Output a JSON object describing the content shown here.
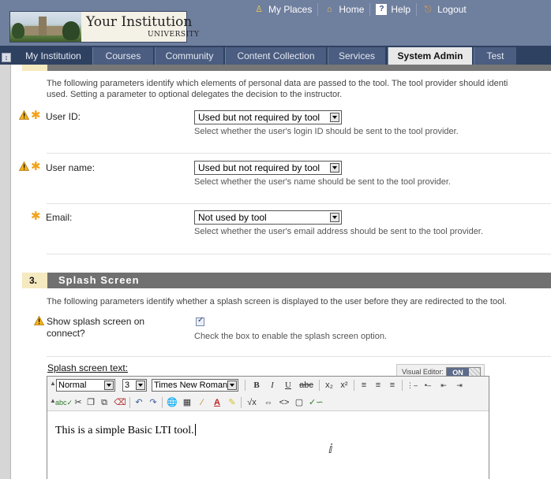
{
  "header": {
    "logo_name": "Your Institution",
    "logo_sub": "UNIVERSITY",
    "links": [
      {
        "label": "My Places",
        "icon": "person-icon"
      },
      {
        "label": "Home",
        "icon": "home-icon"
      },
      {
        "label": "Help",
        "icon": "help-icon"
      },
      {
        "label": "Logout",
        "icon": "logout-icon"
      }
    ]
  },
  "tabs": [
    {
      "label": "My Institution"
    },
    {
      "label": "Courses"
    },
    {
      "label": "Community"
    },
    {
      "label": "Content Collection"
    },
    {
      "label": "Services"
    },
    {
      "label": "System Admin",
      "active": true
    },
    {
      "label": "Test"
    }
  ],
  "personal_data": {
    "description_line1": "The following parameters identify which elements of personal data are passed to the tool. The tool provider should identi",
    "description_line2": "used. Setting a parameter to optional delegates the decision to the instructor.",
    "user_id": {
      "label": "User ID:",
      "value": "Used but not required by tool",
      "help": "Select whether the user's login ID should be sent to the tool provider."
    },
    "user_name": {
      "label": "User name:",
      "value": "Used but not required by tool",
      "help": "Select whether the user's name should be sent to the tool provider."
    },
    "email": {
      "label": "Email:",
      "value": "Not used by tool",
      "help": "Select whether the user's email address should be sent to the tool provider."
    }
  },
  "splash_section": {
    "number": "3.",
    "title": "Splash Screen",
    "description": "The following parameters identify whether a splash screen is displayed to the user before they are redirected to the tool.",
    "show_splash": {
      "label_line1": "Show splash screen on",
      "label_line2": "connect?",
      "checked": true,
      "help": "Check the box to enable the splash screen option."
    },
    "splash_text_label": "Splash screen text:"
  },
  "editor": {
    "visual_editor_label": "Visual Editor:",
    "visual_editor_state": "ON",
    "format": "Normal",
    "size": "3",
    "font": "Times New Roman",
    "content": "This is a simple Basic LTI tool."
  },
  "colors": {
    "header_bg": "#6f7f9e",
    "tab_bar": "#2f4161",
    "section_header": "#707070",
    "required_star": "#f2a31a",
    "warning": "#f5b21b"
  }
}
